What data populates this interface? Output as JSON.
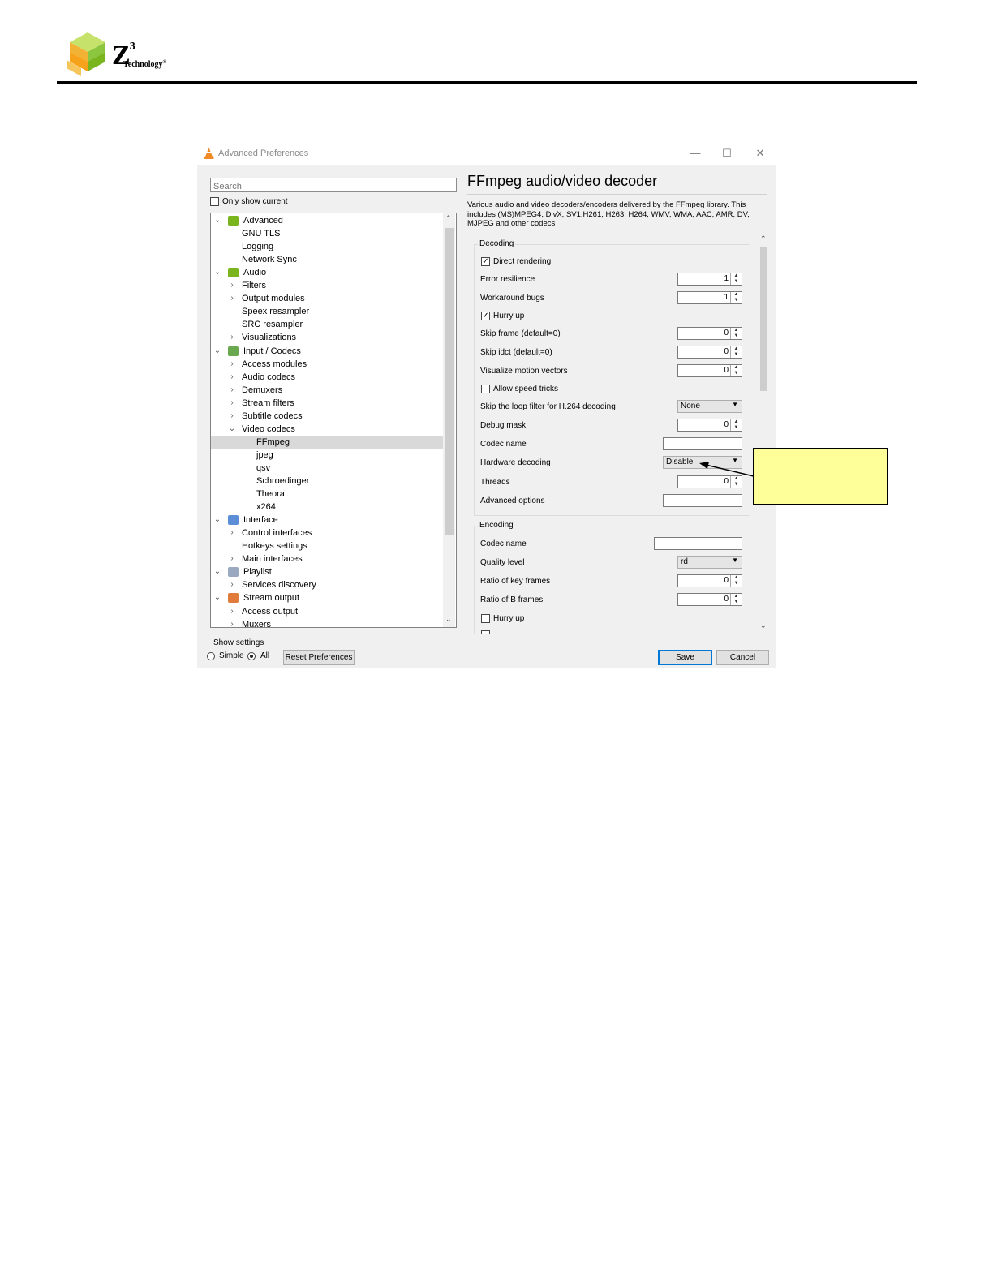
{
  "document": {
    "logo": {
      "mark": "Z",
      "superscript": "3",
      "wordmark": "Technology",
      "registered": "®"
    }
  },
  "window": {
    "title": "Advanced Preferences",
    "controls": {
      "minimize": "—",
      "maximize": "☐",
      "close": "✕"
    },
    "search_placeholder": "Search",
    "only_show_current": "Only show current",
    "tree": [
      {
        "label": "Advanced",
        "expander": "v",
        "icon": "advanced-icon",
        "selected": false
      },
      {
        "label": "GNU TLS",
        "expander": "",
        "selected": false
      },
      {
        "label": "Logging",
        "expander": "",
        "selected": false
      },
      {
        "label": "Network Sync",
        "expander": "",
        "selected": false
      },
      {
        "label": "Audio",
        "expander": "v",
        "icon": "audio-icon",
        "selected": false
      },
      {
        "label": "Filters",
        "expander": ">",
        "selected": false
      },
      {
        "label": "Output modules",
        "expander": ">",
        "selected": false
      },
      {
        "label": "Speex resampler",
        "expander": "",
        "selected": false
      },
      {
        "label": "SRC resampler",
        "expander": "",
        "selected": false
      },
      {
        "label": "Visualizations",
        "expander": ">",
        "selected": false
      },
      {
        "label": "Input / Codecs",
        "expander": "v",
        "icon": "codecs-icon",
        "selected": false
      },
      {
        "label": "Access modules",
        "expander": ">",
        "selected": false
      },
      {
        "label": "Audio codecs",
        "expander": ">",
        "selected": false
      },
      {
        "label": "Demuxers",
        "expander": ">",
        "selected": false
      },
      {
        "label": "Stream filters",
        "expander": ">",
        "selected": false
      },
      {
        "label": "Subtitle codecs",
        "expander": ">",
        "selected": false
      },
      {
        "label": "Video codecs",
        "expander": "v",
        "selected": false
      },
      {
        "label": "FFmpeg",
        "expander": "",
        "selected": true
      },
      {
        "label": "jpeg",
        "expander": "",
        "selected": false
      },
      {
        "label": "qsv",
        "expander": "",
        "selected": false
      },
      {
        "label": "Schroedinger",
        "expander": "",
        "selected": false
      },
      {
        "label": "Theora",
        "expander": "",
        "selected": false
      },
      {
        "label": "x264",
        "expander": "",
        "selected": false
      },
      {
        "label": "Interface",
        "expander": "v",
        "icon": "interface-icon",
        "selected": false
      },
      {
        "label": "Control interfaces",
        "expander": ">",
        "selected": false
      },
      {
        "label": "Hotkeys settings",
        "expander": "",
        "selected": false
      },
      {
        "label": "Main interfaces",
        "expander": ">",
        "selected": false
      },
      {
        "label": "Playlist",
        "expander": "v",
        "icon": "playlist-icon",
        "selected": false
      },
      {
        "label": "Services discovery",
        "expander": ">",
        "selected": false
      },
      {
        "label": "Stream output",
        "expander": "v",
        "icon": "stream-output-icon",
        "selected": false
      },
      {
        "label": "Access output",
        "expander": ">",
        "selected": false
      },
      {
        "label": "Muxers",
        "expander": ">",
        "selected": false
      }
    ],
    "panel": {
      "title": "FFmpeg audio/video decoder",
      "description": "Various audio and video decoders/encoders delivered by the FFmpeg library. This includes (MS)MPEG4, DivX, SV1,H261, H263, H264, WMV, WMA, AAC, AMR, DV, MJPEG and other codecs",
      "decoding_group": "Decoding",
      "decoding": {
        "direct_rendering": {
          "label": "Direct rendering",
          "checked": true
        },
        "error_resilience": {
          "label": "Error resilience",
          "value": "1"
        },
        "workaround_bugs": {
          "label": "Workaround bugs",
          "value": "1"
        },
        "hurry_up": {
          "label": "Hurry up",
          "checked": true
        },
        "skip_frame": {
          "label": "Skip frame (default=0)",
          "value": "0"
        },
        "skip_idct": {
          "label": "Skip idct (default=0)",
          "value": "0"
        },
        "visualize_motion_vectors": {
          "label": "Visualize motion vectors",
          "value": "0"
        },
        "allow_speed_tricks": {
          "label": "Allow speed tricks",
          "checked": false
        },
        "skip_loop_filter": {
          "label": "Skip the loop filter for H.264 decoding",
          "value": "None"
        },
        "debug_mask": {
          "label": "Debug mask",
          "value": "0"
        },
        "codec_name": {
          "label": "Codec name",
          "value": ""
        },
        "hardware_decoding": {
          "label": "Hardware decoding",
          "value": "Disable"
        },
        "threads": {
          "label": "Threads",
          "value": "0"
        },
        "advanced_options": {
          "label": "Advanced options",
          "value": ""
        }
      },
      "encoding_group": "Encoding",
      "encoding": {
        "codec_name": {
          "label": "Codec name",
          "value": ""
        },
        "quality_level": {
          "label": "Quality level",
          "value": "rd"
        },
        "ratio_key_frames": {
          "label": "Ratio of key frames",
          "value": "0"
        },
        "ratio_b_frames": {
          "label": "Ratio of B frames",
          "value": "0"
        },
        "hurry_up": {
          "label": "Hurry up",
          "checked": false
        }
      }
    },
    "footer": {
      "show_settings": "Show settings",
      "simple": "Simple",
      "all": "All",
      "selected_mode": "All",
      "reset": "Reset Preferences",
      "save": "Save",
      "cancel": "Cancel"
    }
  },
  "colors": {
    "callout_fill": "#ffff99",
    "selected_row": "#d9d9d9",
    "save_border": "#0078d7",
    "vlc_orange": "#f08a24",
    "icon_green": "#7ab51d"
  }
}
